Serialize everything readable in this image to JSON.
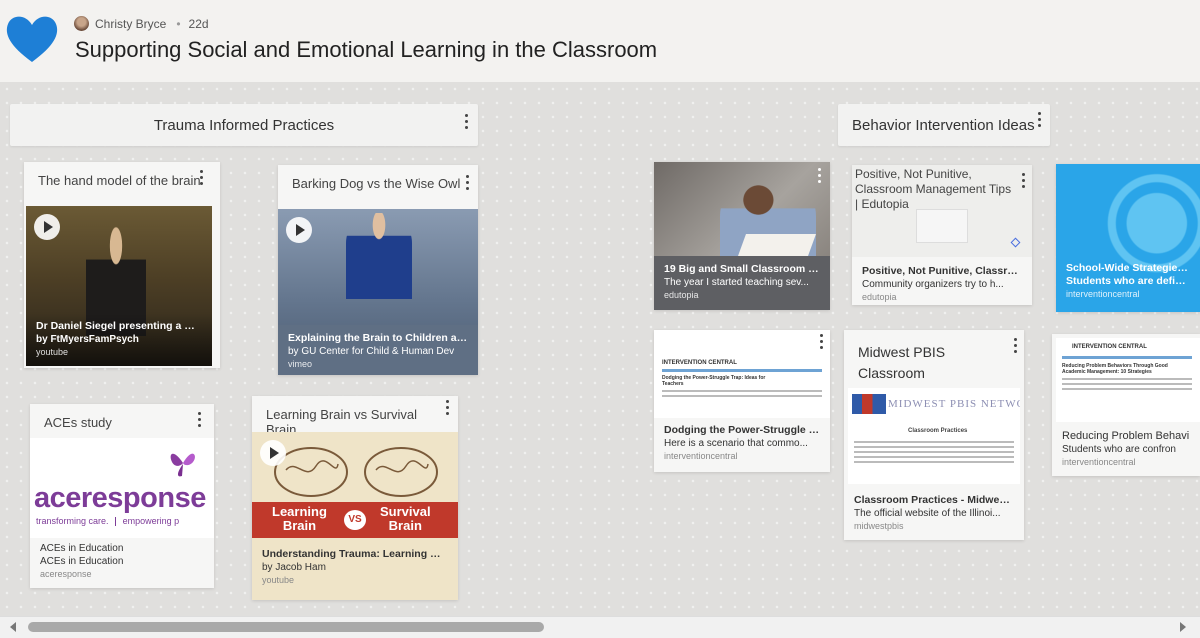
{
  "header": {
    "author": "Christy Bryce",
    "age": "22d",
    "title": "Supporting Social and Emotional Learning in the Classroom"
  },
  "colors": {
    "heart": "#1e7fd6",
    "accent_blue": "#2aa5e8"
  },
  "sections": [
    {
      "title": "Trauma Informed Practices"
    },
    {
      "title": "Behavior Intervention Ideas"
    }
  ],
  "cards": {
    "hand_model": {
      "heading": "The hand model of the brain",
      "title": "Dr Daniel Siegel presenting a Ha...",
      "sub": "by FtMyersFamPsych",
      "source": "youtube"
    },
    "barking_dog": {
      "heading": "Barking Dog vs the Wise Owl",
      "title": "Explaining the Brain to Children an...",
      "sub": "by GU Center for Child & Human Dev",
      "source": "vimeo"
    },
    "aces": {
      "heading": "ACEs study",
      "logo_main": "aceresponse",
      "logo_tag1": "transforming care.",
      "logo_tag2": "empowering p",
      "title": "ACEs in Education",
      "sub": "ACEs in Education",
      "source": "aceresponse"
    },
    "learning_brain": {
      "heading": "Learning Brain vs Survival Brain",
      "banner_left_1": "Learning",
      "banner_left_2": "Brain",
      "banner_vs": "VS",
      "banner_right_1": "Survival",
      "banner_right_2": "Brain",
      "title": "Understanding Trauma: Learning Br...",
      "sub": "by Jacob Ham",
      "source": "youtube"
    },
    "classroom_moves": {
      "title": "19 Big and Small Classroom M...",
      "sub": "The year I started teaching sev...",
      "source": "edutopia"
    },
    "power_struggle": {
      "site_name": "INTERVENTION CENTRAL",
      "doc_heading": "Dodging the Power-Struggle Trap: Ideas for Teachers",
      "title": "Dodging the Power-Struggle Tr...",
      "sub": "Here is a scenario that commo...",
      "source": "interventioncentral"
    },
    "positive_not_punitive": {
      "alt": "Positive, Not Punitive, Classroom Management Tips | Edutopia",
      "title": "Positive, Not Punitive, Classro...",
      "sub": "Community organizers try to h...",
      "source": "edutopia"
    },
    "midwest_pbis": {
      "heading": "Midwest PBIS Classroom Management",
      "banner": "MIDWEST PBIS NETWO",
      "page_heading": "Classroom Practices",
      "title": "Classroom Practices - Midwest ...",
      "sub": "The official website of the Illinoi...",
      "source": "midwestpbis"
    },
    "school_wide": {
      "title": "School-Wide Strategies fo",
      "sub": "Students who are defiant o",
      "source": "interventioncentral"
    },
    "reducing_problem": {
      "site_name": "INTERVENTION CENTRAL",
      "doc_heading": "Reducing Problem Behaviors Through Good Academic Management: 10 Strategies",
      "title": "Reducing Problem Behavi",
      "sub": "Students who are confron",
      "source": "interventioncentral"
    }
  }
}
